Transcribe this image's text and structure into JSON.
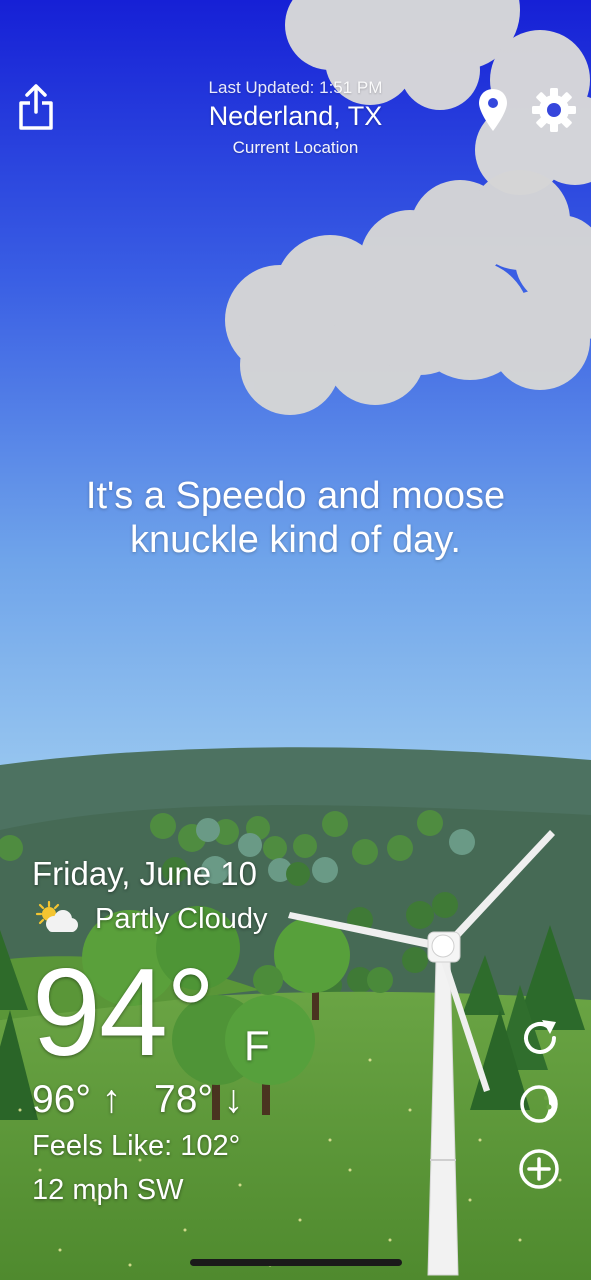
{
  "header": {
    "last_updated": "Last Updated: 1:51 PM",
    "location": "Nederland, TX",
    "location_caption": "Current Location",
    "icons": {
      "share": "share-icon",
      "pin": "location-pin-icon",
      "settings": "gear-icon"
    }
  },
  "tagline": "It's a Speedo and moose knuckle kind of day.",
  "weather": {
    "date": "Friday, June 10",
    "condition": "Partly Cloudy",
    "condition_icon": "partly-cloudy-icon",
    "temperature": "94°",
    "unit": "F",
    "high": "96° ↑",
    "low": "78° ↓",
    "feels_like": "Feels Like: 102°",
    "wind": "12 mph SW"
  },
  "actions": {
    "icons": {
      "refresh": "refresh-icon",
      "moon": "moon-phase-icon",
      "add": "add-icon"
    }
  },
  "colors": {
    "sky_top": "#1a24d8",
    "sky_bottom": "#8cc0ee",
    "hills": "#486c58",
    "grass": "#5f9a3a",
    "text": "#ffffff"
  }
}
